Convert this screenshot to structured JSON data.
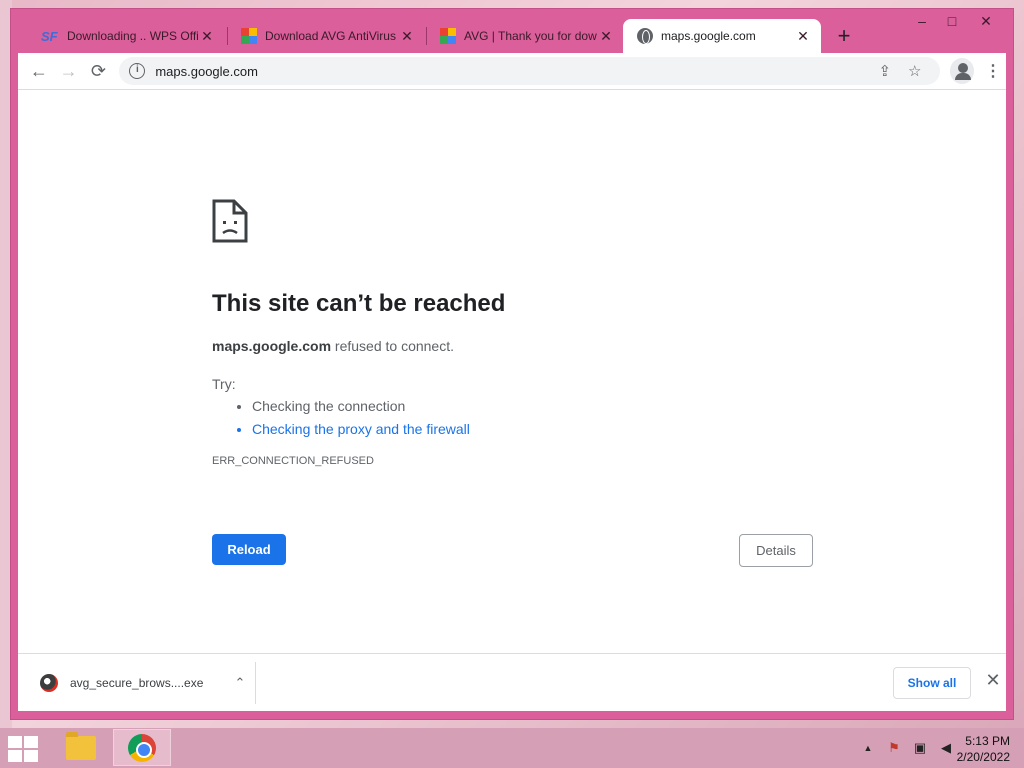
{
  "tabs": [
    {
      "title": "Downloading .. WPS Offi",
      "favicon": "sf-icon"
    },
    {
      "title": "Download AVG AntiVirus",
      "favicon": "avg-icon"
    },
    {
      "title": "AVG | Thank you for dow",
      "favicon": "avg-icon"
    },
    {
      "title": "maps.google.com",
      "favicon": "globe-icon",
      "active": true
    }
  ],
  "new_tab_label": "+",
  "window_controls": {
    "minimize": "–",
    "maximize": "□",
    "close": "✕"
  },
  "toolbar": {
    "back": "←",
    "forward": "→",
    "reload": "⟳",
    "url": "maps.google.com",
    "info_glyph": "i",
    "share_glyph": "⇪",
    "star_glyph": "☆",
    "menu_glyph": "⋮"
  },
  "error": {
    "title": "This site can’t be reached",
    "host": "maps.google.com",
    "message": " refused to connect.",
    "try_label": "Try:",
    "suggestions": [
      "Checking the connection",
      "Checking the proxy and the firewall"
    ],
    "code": "ERR_CONNECTION_REFUSED",
    "reload_label": "Reload",
    "details_label": "Details"
  },
  "downloads": {
    "file_name": "avg_secure_brows....exe",
    "show_all_label": "Show all",
    "close_glyph": "✕",
    "chevron_glyph": "⌃"
  },
  "taskbar": {
    "time": "5:13 PM",
    "date": "2/20/2022",
    "tray_up": "▲"
  },
  "colors": {
    "window_frame": "#da5f9a",
    "accent": "#1a73e8",
    "taskbar": "#d59fb6"
  }
}
